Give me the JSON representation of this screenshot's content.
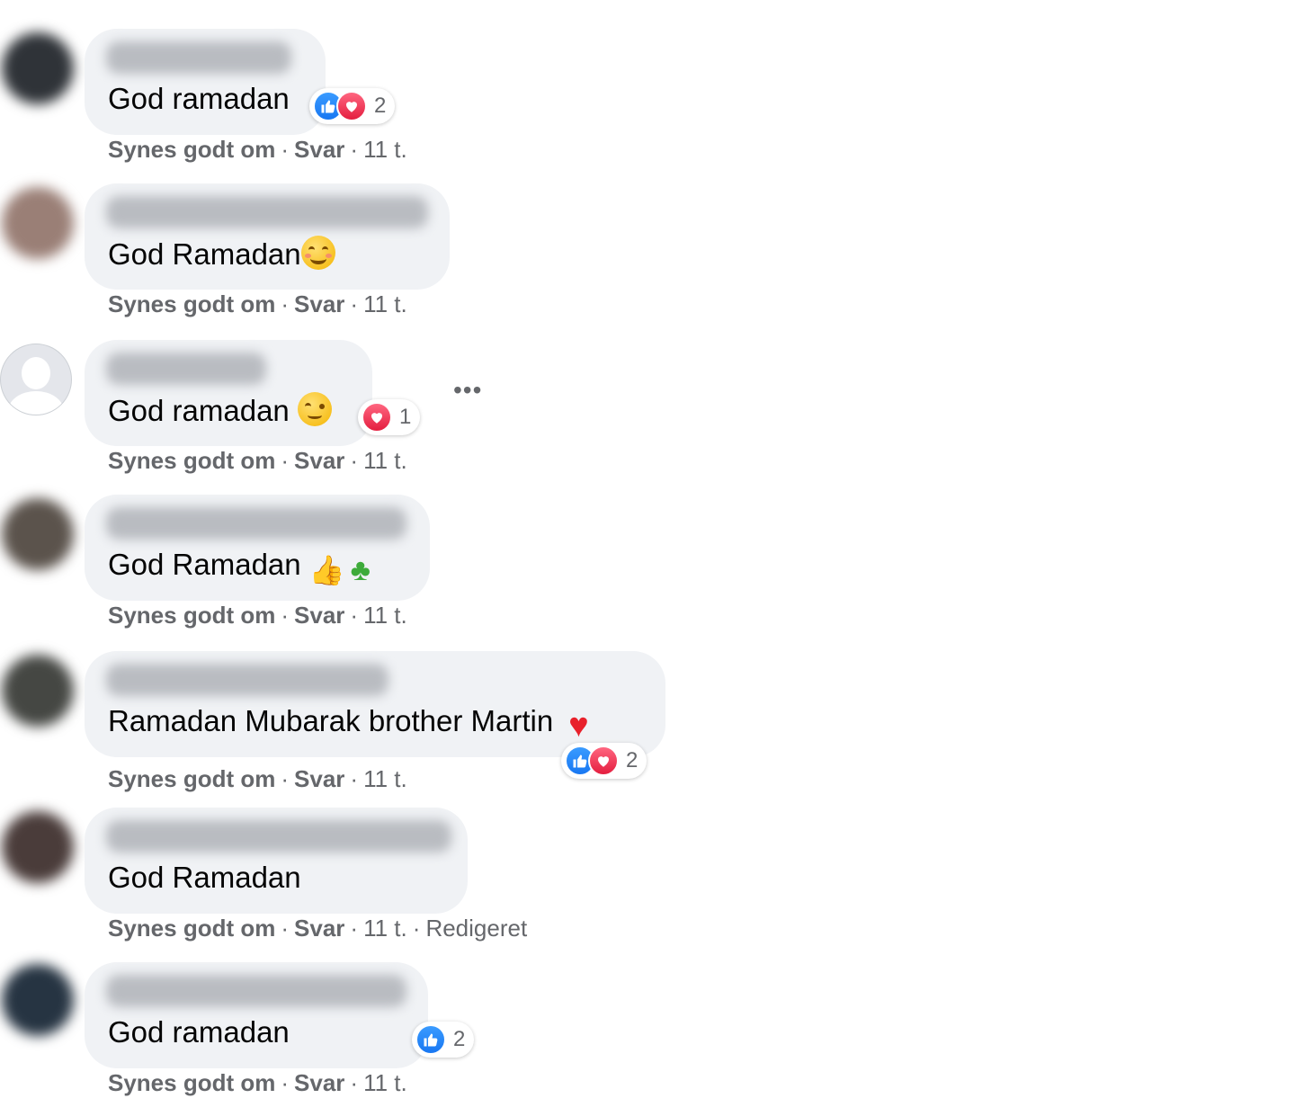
{
  "labels": {
    "like": "Synes godt om",
    "reply": "Svar",
    "separator": "·",
    "more": "•••"
  },
  "comments": [
    {
      "text": "God ramadan",
      "emoji": [],
      "reactions": [
        "like",
        "love"
      ],
      "reaction_count": "2",
      "time": "11 t.",
      "edited": "",
      "avatar_color": "#2f3338"
    },
    {
      "text": "God Ramadan",
      "emoji": [
        "smile"
      ],
      "reactions": [],
      "reaction_count": "",
      "time": "11 t.",
      "edited": "",
      "avatar_color": "#9a7f76"
    },
    {
      "text": "God ramadan ",
      "emoji": [
        "wink"
      ],
      "reactions": [
        "love"
      ],
      "reaction_count": "1",
      "time": "11 t.",
      "edited": "",
      "avatar_color": "default"
    },
    {
      "text": "God Ramadan ",
      "emoji": [
        "thumbs-up",
        "four-leaf-clover"
      ],
      "reactions": [],
      "reaction_count": "",
      "time": "11 t.",
      "edited": "",
      "avatar_color": "#5b534c"
    },
    {
      "text": "Ramadan Mubarak brother Martin ",
      "emoji": [
        "red-heart"
      ],
      "reactions": [
        "like",
        "love"
      ],
      "reaction_count": "2",
      "time": "11 t.",
      "edited": "",
      "avatar_color": "#454743"
    },
    {
      "text": "God Ramadan",
      "emoji": [],
      "reactions": [],
      "reaction_count": "",
      "time": "11 t.",
      "edited": "Redigeret",
      "avatar_color": "#4a3c3a"
    },
    {
      "text": "God ramadan",
      "emoji": [],
      "reactions": [
        "like"
      ],
      "reaction_count": "2",
      "time": "11 t.",
      "edited": "",
      "avatar_color": "#263442"
    }
  ],
  "colors": {
    "bubble": "#f0f2f5",
    "meta_text": "#65676b",
    "like_blue": "#1877f2",
    "love_red": "#e41e3f"
  }
}
